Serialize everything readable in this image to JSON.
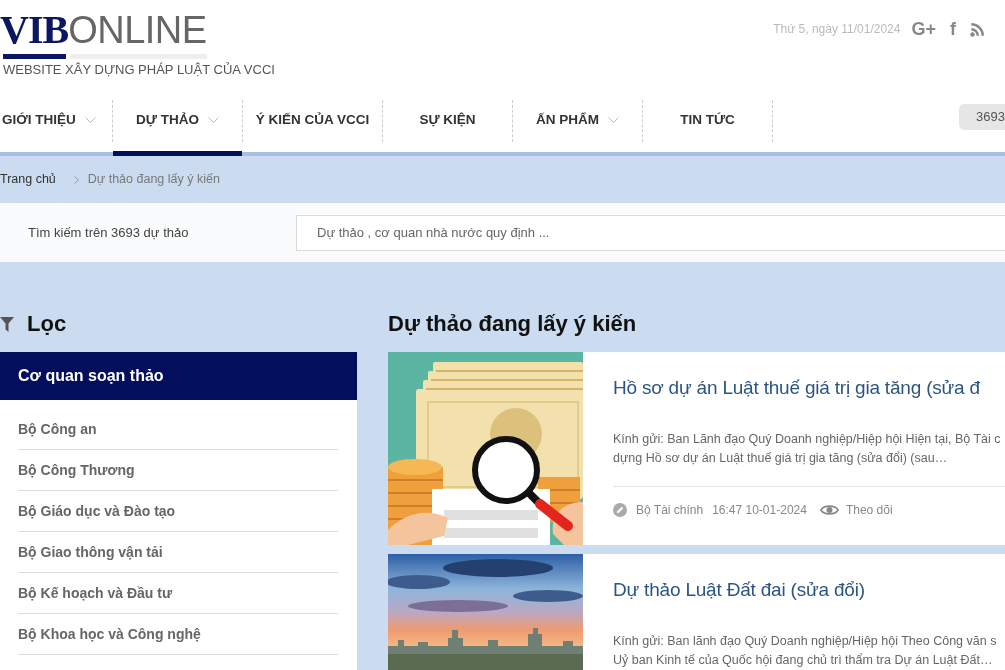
{
  "header": {
    "logo": {
      "bold": "VIB",
      "light": "ONLINE"
    },
    "tagline": "WEBSITE XÂY DỰNG PHÁP LUẬT CỦA VCCI",
    "date": "Thứ 5, ngày 11/01/2024",
    "social": [
      {
        "kind": "glyph",
        "glyph": "G+"
      },
      {
        "kind": "glyph",
        "glyph": "f"
      },
      {
        "kind": "rss"
      }
    ]
  },
  "nav": {
    "items": [
      {
        "label": "GIỚI THIỆU",
        "dropdown": true,
        "selected": false
      },
      {
        "label": "DỰ THẢO",
        "dropdown": true,
        "selected": true
      },
      {
        "label": "Ý KIẾN CỦA VCCI",
        "dropdown": false,
        "selected": false
      },
      {
        "label": "SỰ KIỆN",
        "dropdown": false,
        "selected": false
      },
      {
        "label": "ẤN PHẨM",
        "dropdown": true,
        "selected": false
      },
      {
        "label": "TIN TỨC",
        "dropdown": false,
        "selected": false
      }
    ],
    "counter": "3693"
  },
  "breadcrumb": [
    "Trang chủ",
    "Dự thảo đang lấy ý kiến"
  ],
  "search": {
    "label": "Tìm kiếm trên 3693 dự thảo",
    "placeholder": "Dự thảo , cơ quan nhà nước quy định ..."
  },
  "filter": {
    "title": "Lọc",
    "panel_title": "Cơ quan soạn thảo",
    "items": [
      "Bộ Công an",
      "Bộ Công Thương",
      "Bộ Giáo dục và Đào tạo",
      "Bộ Giao thông vận tải",
      "Bộ Kế hoạch và Đầu tư",
      "Bộ Khoa học và Công nghệ"
    ]
  },
  "drafts": {
    "title": "Dự thảo đang lấy ý kiến",
    "items": [
      {
        "kind": "illustration",
        "title": "Hồ sơ dự án Luật thuế giá trị gia tăng (sửa đ",
        "excerpt_lines": [
          "Kính gửi: Ban Lãnh đạo Quý Doanh nghiệp/Hiệp hội Hiện tại, Bộ Tài c",
          "dựng Hồ sơ dự án Luật thuế giá trị gia tăng (sửa đổi) (sau…"
        ],
        "meta": {
          "agency": "Bộ Tài chính",
          "time": "16:47 10-01-2024",
          "follow": "Theo dõi"
        }
      },
      {
        "kind": "photo",
        "title": "Dự thảo Luật Đất đai (sửa đổi)",
        "excerpt_lines": [
          "Kính gửi: Ban lãnh đạo Quý Doanh nghiệp/Hiệp hội Theo Công văn s",
          "Uỷ ban Kinh tế của Quốc hội đang chủ trì thẩm tra Dự án Luật Đất…"
        ]
      }
    ]
  }
}
